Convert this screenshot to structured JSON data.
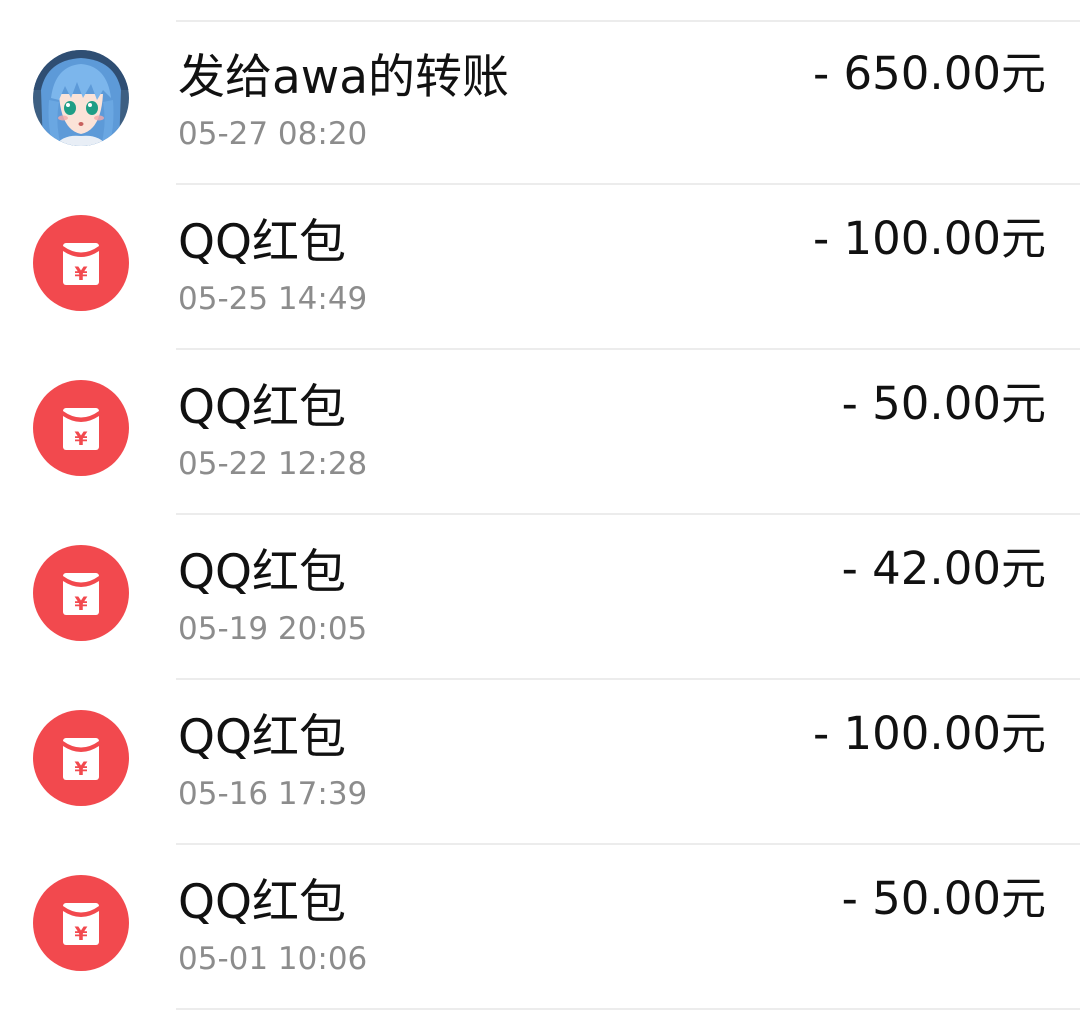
{
  "transactions": [
    {
      "icon": "avatar-anime-girl",
      "title": "发给awa的转账",
      "time": "05-27 08:20",
      "amount": "- 650.00元"
    },
    {
      "icon": "red-envelope-yuan-icon",
      "title": "QQ红包",
      "time": "05-25 14:49",
      "amount": "- 100.00元"
    },
    {
      "icon": "red-envelope-yuan-icon",
      "title": "QQ红包",
      "time": "05-22 12:28",
      "amount": "- 50.00元"
    },
    {
      "icon": "red-envelope-yuan-icon",
      "title": "QQ红包",
      "time": "05-19 20:05",
      "amount": "- 42.00元"
    },
    {
      "icon": "red-envelope-yuan-icon",
      "title": "QQ红包",
      "time": "05-16 17:39",
      "amount": "- 100.00元"
    },
    {
      "icon": "red-envelope-yuan-icon",
      "title": "QQ红包",
      "time": "05-01 10:06",
      "amount": "- 50.00元"
    }
  ],
  "colors": {
    "red_envelope": "#f2494e",
    "time_text": "#8c8c8c",
    "primary_text": "#111111",
    "divider": "#ececec"
  }
}
